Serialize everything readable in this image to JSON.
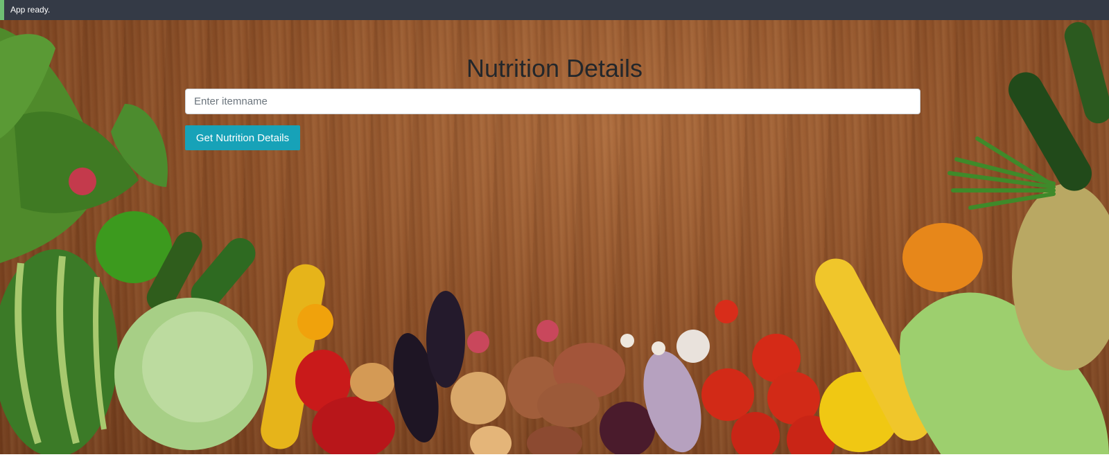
{
  "status": {
    "message": "App ready.",
    "accent_color": "#6fbf73",
    "background_color": "#343a46"
  },
  "page": {
    "title": "Nutrition Details"
  },
  "search": {
    "placeholder": "Enter itemname",
    "value": ""
  },
  "actions": {
    "submit_label": "Get Nutrition Details",
    "submit_color": "#17a2b8"
  },
  "background": {
    "description_icon": "vegetables-on-wooden-table-image"
  }
}
